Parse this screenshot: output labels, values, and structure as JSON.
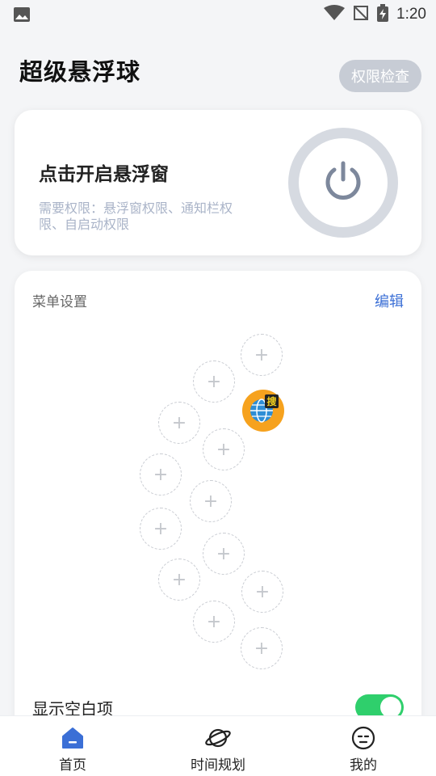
{
  "status_bar": {
    "time": "1:20"
  },
  "header": {
    "title": "超级悬浮球",
    "permission_check_label": "权限检查"
  },
  "power_card": {
    "title": "点击开启悬浮窗",
    "description": "需要权限：悬浮窗权限、通知栏权限、自启动权限"
  },
  "menu_card": {
    "title": "菜单设置",
    "edit_label": "编辑",
    "slot_plus": "+",
    "app_badge": "搜",
    "show_blank_label": "显示空白项",
    "show_blank_on": true
  },
  "bottom_nav": {
    "items": [
      {
        "label": "首页",
        "icon": "home-icon",
        "active": true
      },
      {
        "label": "时间规划",
        "icon": "planet-icon",
        "active": false
      },
      {
        "label": "我的",
        "icon": "face-icon",
        "active": false
      }
    ]
  },
  "colors": {
    "accent": "#3b6fd6",
    "toggle": "#2fcf6c",
    "app_icon_bg": "#f6a21e",
    "power_gray": "#7d889c"
  }
}
